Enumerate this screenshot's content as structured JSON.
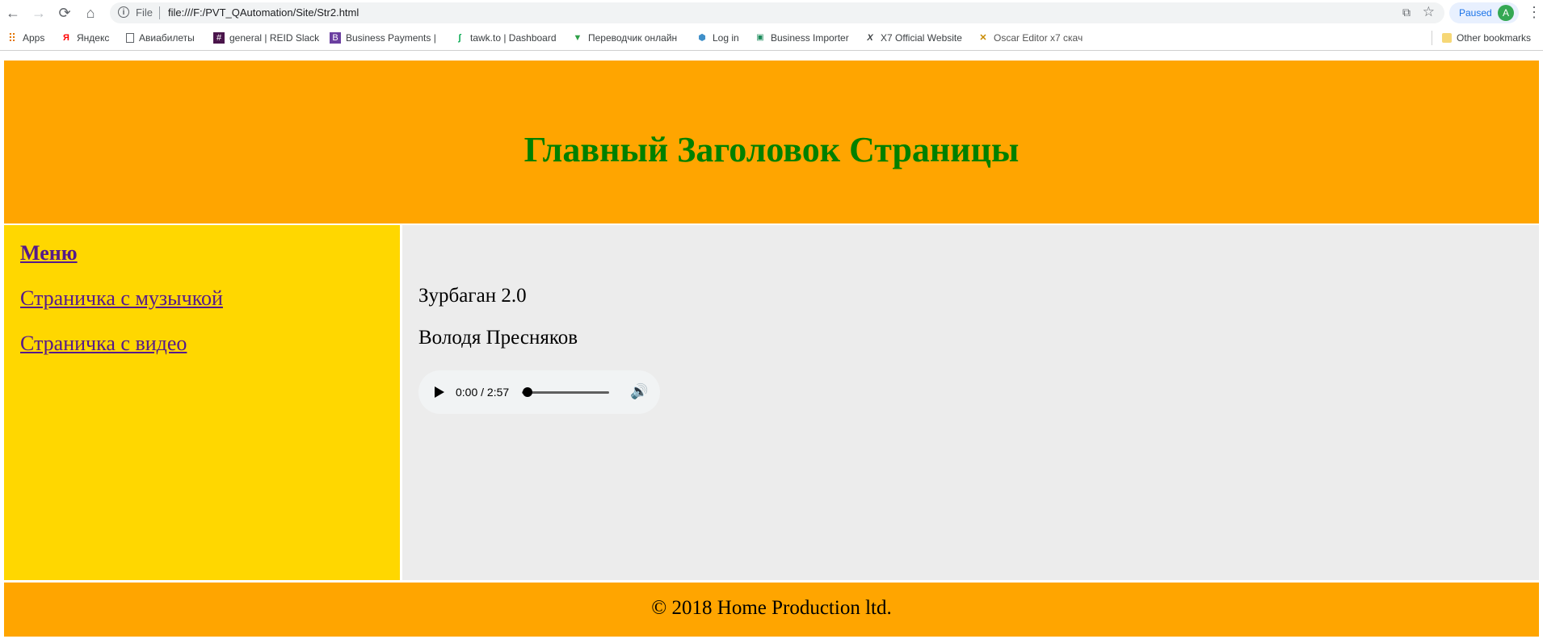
{
  "browser": {
    "nav": {
      "back_icon": "←",
      "forward_icon": "→",
      "reload_icon": "⟳",
      "home_icon": "⌂"
    },
    "omnibox": {
      "info_icon": "i",
      "scheme_label": "File",
      "url": "file:///F:/PVT_QAutomation/Site/Str2.html",
      "translate_icon": "⧉",
      "star_icon": "☆"
    },
    "profile": {
      "status": "Paused",
      "avatar_letter": "A"
    },
    "menu_icon": "⋮",
    "bookmarks": [
      {
        "label": "Apps",
        "icon": "apps-grid-icon"
      },
      {
        "label": "Яндекс",
        "icon": "yandex-icon"
      },
      {
        "label": "Авиабилеты",
        "icon": "page-icon"
      },
      {
        "label": "general | REID Slack",
        "icon": "slack-hash-icon"
      },
      {
        "label": "Business Payments |",
        "icon": "business-icon"
      },
      {
        "label": "tawk.to | Dashboard",
        "icon": "tawk-icon"
      },
      {
        "label": "Переводчик онлайн",
        "icon": "translator-icon"
      },
      {
        "label": "Log in",
        "icon": "login-icon"
      },
      {
        "label": "Business Importer",
        "icon": "importer-icon"
      },
      {
        "label": "X7 Official Website",
        "icon": "x7-icon"
      },
      {
        "label": "Oscar Editor x7 скач",
        "icon": "oscar-icon"
      }
    ],
    "other_bookmarks": "Other bookmarks"
  },
  "page": {
    "header_title": "Главный Заголовок Страницы",
    "menu": {
      "title": "Меню",
      "items": [
        "Страничка с музычкой",
        "Страничка с видео"
      ]
    },
    "track": {
      "title": "Зурбаган 2.0",
      "artist": "Володя Пресняков"
    },
    "player": {
      "time": "0:00 / 2:57",
      "progress": 0.0
    },
    "footer": "© 2018 Home Production ltd."
  },
  "colors": {
    "header_bg": "#ffa500",
    "header_text": "#008000",
    "sidebar_bg": "#ffd700",
    "main_bg": "#ececec",
    "link": "#551a8b"
  }
}
